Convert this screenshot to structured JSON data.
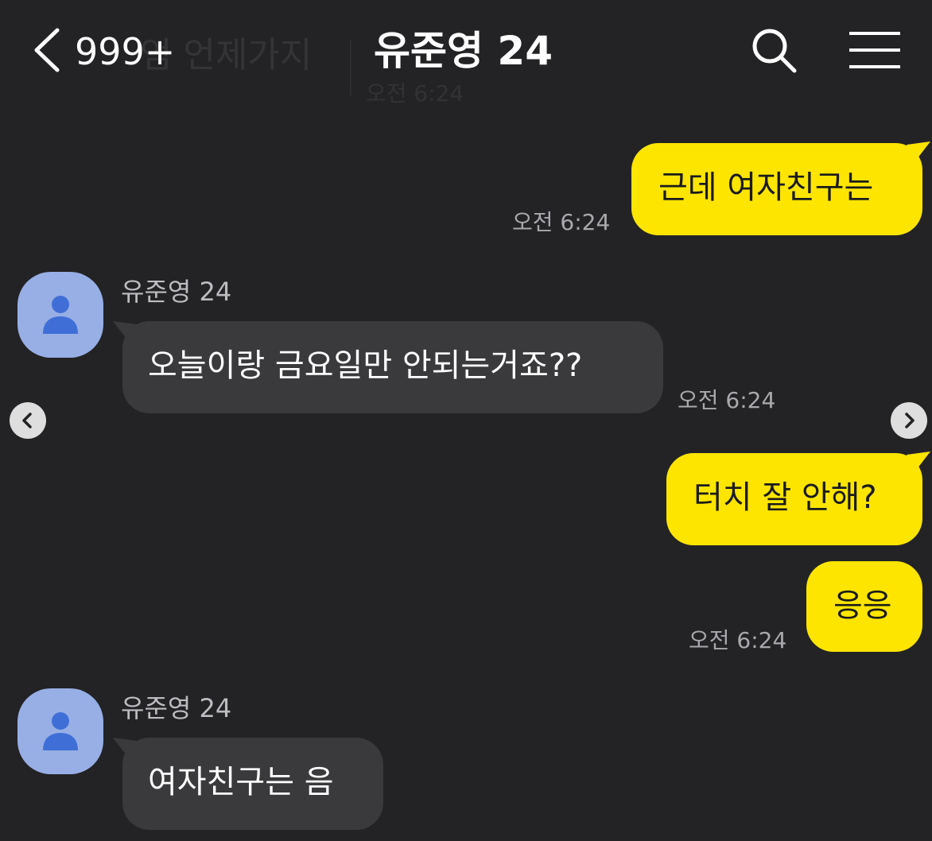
{
  "header": {
    "back_icon": "chevron-left-icon",
    "unread_count": "999+",
    "title": "유준영 24",
    "ghost_text": "엄 언제가지",
    "ghost_time": "오전 6:24",
    "search_icon": "search-icon",
    "menu_icon": "hamburger-menu-icon"
  },
  "colors": {
    "background": "#232325",
    "my_bubble": "#fee500",
    "their_bubble": "#3a3a3c",
    "avatar": "#98afe6"
  },
  "messages": [
    {
      "from": "me",
      "text": "근데 여자친구는",
      "time": "오전 6:24"
    },
    {
      "from": "them",
      "sender": "유준영 24",
      "text": "오늘이랑 금요일만 안되는거죠??",
      "time": "오전 6:24"
    },
    {
      "from": "me",
      "text": "터치 잘 안해?"
    },
    {
      "from": "me",
      "text": "응응",
      "time": "오전 6:24"
    },
    {
      "from": "them",
      "sender": "유준영 24",
      "text": "여자친구는 음"
    }
  ],
  "carousel": {
    "prev_icon": "carousel-prev-icon",
    "next_icon": "carousel-next-icon"
  }
}
